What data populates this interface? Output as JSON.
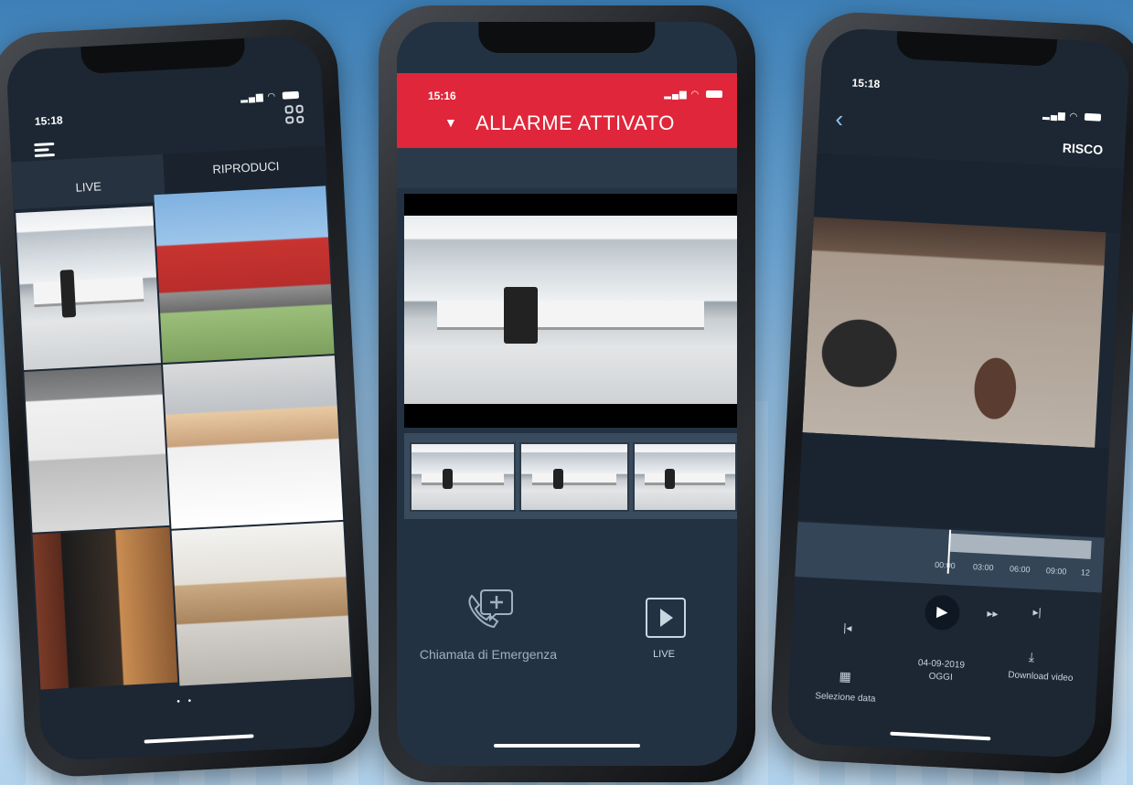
{
  "phone1": {
    "time": "15:18",
    "tabs": [
      "LIVE",
      "RIPRODUCI"
    ],
    "menu_icon": "hamburger-menu-icon",
    "grid_icon": "grid-view-icon",
    "page_dots": "• •"
  },
  "phone2": {
    "time": "15:16",
    "alarm_title": "ALLARME ATTIVATO",
    "alarm_color": "#e0263a",
    "emergency_label": "Chiamata di Emergenza",
    "live_label": "LIVE"
  },
  "phone3": {
    "time": "15:18",
    "brand": "RISCO",
    "timeline_ticks": [
      "00:00",
      "03:00",
      "06:00",
      "09:00",
      "12"
    ],
    "date": "04-09-2019",
    "date_sub": "OGGI",
    "select_date_label": "Selezione data",
    "download_label": "Download video"
  }
}
